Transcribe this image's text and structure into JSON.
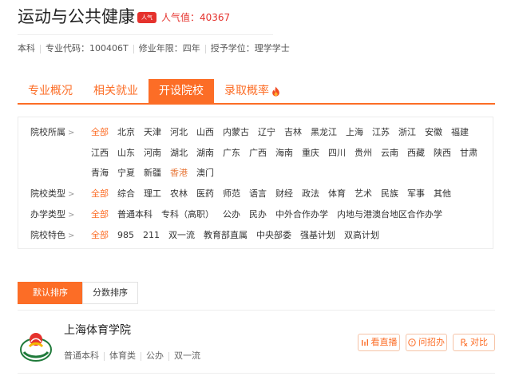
{
  "header": {
    "title": "运动与公共健康",
    "hot_badge": "人气",
    "hot_prefix": "人气值：",
    "hot_value": "40367"
  },
  "meta": {
    "level": "本科",
    "code": "专业代码：100406T",
    "years": "修业年限：四年",
    "degree": "授予学位：理学学士"
  },
  "tabs": [
    {
      "label": "专业概况",
      "active": false
    },
    {
      "label": "相关就业",
      "active": false
    },
    {
      "label": "开设院校",
      "active": true
    },
    {
      "label": "录取概率",
      "active": false
    }
  ],
  "filters": {
    "location": {
      "label": "院校所属",
      "row1": [
        "全部",
        "北京",
        "天津",
        "河北",
        "山西",
        "内蒙古",
        "辽宁",
        "吉林",
        "黑龙江",
        "上海",
        "江苏",
        "浙江",
        "安徽",
        "福建"
      ],
      "row2": [
        "江西",
        "山东",
        "河南",
        "湖北",
        "湖南",
        "广东",
        "广西",
        "海南",
        "重庆",
        "四川",
        "贵州",
        "云南",
        "西藏",
        "陕西",
        "甘肃"
      ],
      "row3": [
        "青海",
        "宁夏",
        "新疆",
        "香港",
        "澳门"
      ]
    },
    "type": {
      "label": "院校类型",
      "options": [
        "全部",
        "综合",
        "理工",
        "农林",
        "医药",
        "师范",
        "语言",
        "财经",
        "政法",
        "体育",
        "艺术",
        "民族",
        "军事",
        "其他"
      ]
    },
    "run": {
      "label": "办学类型",
      "options": [
        "全部",
        "普通本科",
        "专科（高职）",
        "公办",
        "民办",
        "中外合作办学",
        "内地与港澳台地区合作办学"
      ]
    },
    "feature": {
      "label": "院校特色",
      "options": [
        "全部",
        "985",
        "211",
        "双一流",
        "教育部直属",
        "中央部委",
        "强基计划",
        "双高计划"
      ]
    }
  },
  "sort": {
    "default_label": "默认排序",
    "score_label": "分数排序"
  },
  "school": {
    "name": "上海体育学院",
    "tags": [
      "普通本科",
      "体育类",
      "公办",
      "双一流"
    ],
    "buttons": {
      "live": "看直播",
      "ask": "问招办",
      "compare": "对比"
    }
  },
  "colors": {
    "accent": "#fc6d26",
    "hot": "#e5322d"
  }
}
